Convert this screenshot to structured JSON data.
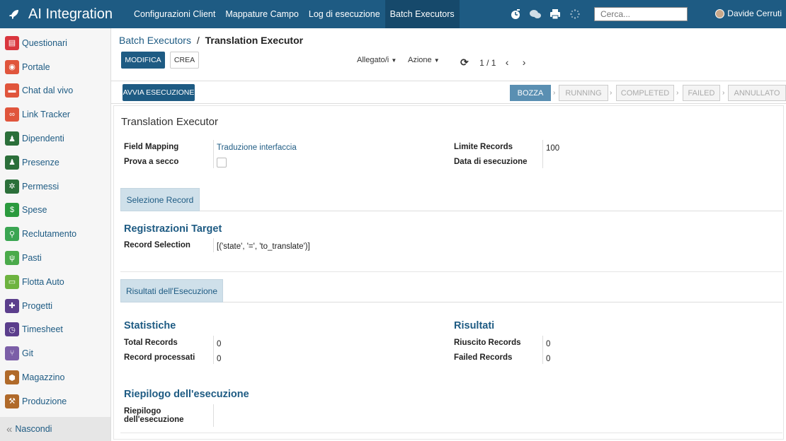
{
  "navbar": {
    "brand": "AI Integration",
    "menu": [
      "Configurazioni Client",
      "Mappature Campo",
      "Log di esecuzione",
      "Batch Executors"
    ],
    "search_placeholder": "Cerca...",
    "user": "Davide Cerruti"
  },
  "sidebar": {
    "items": [
      {
        "label": "Questionari",
        "color": "#d9363e",
        "icon": "clipboard-icon"
      },
      {
        "label": "Portale",
        "color": "#e0553c",
        "icon": "globe-icon"
      },
      {
        "label": "Chat dal vivo",
        "color": "#e0553c",
        "icon": "chat-icon"
      },
      {
        "label": "Link Tracker",
        "color": "#e0553c",
        "icon": "link-icon"
      },
      {
        "label": "Dipendenti",
        "color": "#2b6f3a",
        "icon": "users-icon"
      },
      {
        "label": "Presenze",
        "color": "#2b6f3a",
        "icon": "user-check-icon"
      },
      {
        "label": "Permessi",
        "color": "#2b6f3a",
        "icon": "sun-icon"
      },
      {
        "label": "Spese",
        "color": "#2b9a3e",
        "icon": "dollar-icon"
      },
      {
        "label": "Reclutamento",
        "color": "#3aa552",
        "icon": "search-user-icon"
      },
      {
        "label": "Pasti",
        "color": "#4aaa4a",
        "icon": "cutlery-icon"
      },
      {
        "label": "Flotta Auto",
        "color": "#6db33f",
        "icon": "car-icon"
      },
      {
        "label": "Progetti",
        "color": "#5b3e8c",
        "icon": "puzzle-icon"
      },
      {
        "label": "Timesheet",
        "color": "#5b3e8c",
        "icon": "clock-icon"
      },
      {
        "label": "Git",
        "color": "#7b5ea7",
        "icon": "git-icon"
      },
      {
        "label": "Magazzino",
        "color": "#b06a2a",
        "icon": "box-icon"
      },
      {
        "label": "Produzione",
        "color": "#b06a2a",
        "icon": "wrench-icon"
      }
    ],
    "hide_label": "Nascondi"
  },
  "control": {
    "breadcrumb_parent": "Batch Executors",
    "breadcrumb_sep": "/",
    "breadcrumb_current": "Translation Executor",
    "edit_label": "MODIFICA",
    "create_label": "CREA",
    "attachments_label": "Allegato/i",
    "action_label": "Azione",
    "pager": "1 / 1"
  },
  "statusbar": {
    "run_label": "AVVIA ESECUZIONE",
    "stages": [
      "BOZZA",
      "RUNNING",
      "COMPLETED",
      "FAILED",
      "ANNULLATO"
    ],
    "current_stage": "BOZZA"
  },
  "form": {
    "title": "Translation Executor",
    "field_mapping_label": "Field Mapping",
    "field_mapping_value": "Traduzione interfaccia",
    "dry_run_label": "Prova a secco",
    "limit_label": "Limite Records",
    "limit_value": "100",
    "exec_date_label": "Data di esecuzione",
    "tab_selection": "Selezione Record",
    "target_title": "Registrazioni Target",
    "record_selection_label": "Record Selection",
    "record_selection_value": "[('state', '=', 'to_translate')]",
    "tab_results": "Risultati dell'Esecuzione",
    "stats_title": "Statistiche",
    "total_label": "Total Records",
    "total_value": "0",
    "processed_label": "Record processati",
    "processed_value": "0",
    "results_title": "Risultati",
    "success_label": "Riuscito Records",
    "success_value": "0",
    "failed_label": "Failed Records",
    "failed_value": "0",
    "summary_title": "Riepilogo dell'esecuzione",
    "summary_label_1": "Riepilogo",
    "summary_label_2": "dell'esecuzione"
  }
}
